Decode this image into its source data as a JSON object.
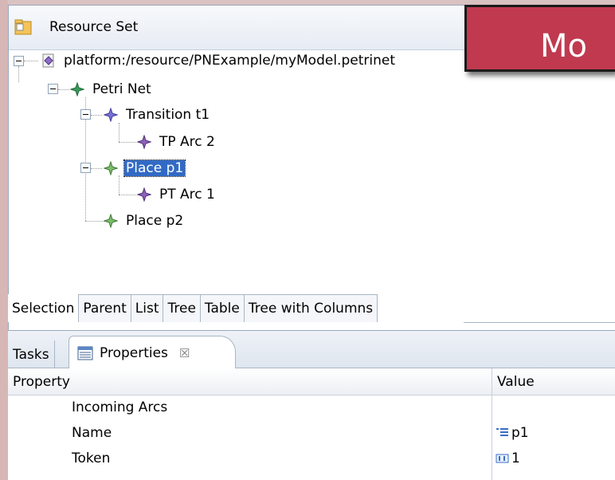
{
  "editor": {
    "header_title": "Resource Set",
    "tree": [
      {
        "label": "platform:/resource/PNExample/myModel.petrinet",
        "icon": "resource-file-icon"
      },
      {
        "label": "Petri Net",
        "icon": "petri-net-node-icon"
      },
      {
        "label": "Transition t1",
        "icon": "transition-node-icon"
      },
      {
        "label": "TP Arc 2",
        "icon": "arc-node-icon"
      },
      {
        "label": "Place p1",
        "icon": "place-node-icon",
        "selected": true
      },
      {
        "label": "PT Arc 1",
        "icon": "arc-node-icon"
      },
      {
        "label": "Place p2",
        "icon": "place-node-icon"
      }
    ],
    "viewer_tabs": [
      "Selection",
      "Parent",
      "List",
      "Tree",
      "Table",
      "Tree with Columns"
    ],
    "active_viewer_tab": "Selection"
  },
  "overlay": {
    "title_text": "Mo",
    "color": "#c0394f"
  },
  "properties_view": {
    "tabs": {
      "tasks": "Tasks",
      "properties": "Properties",
      "close_glyph": "☒"
    },
    "columns": [
      "Property",
      "Value"
    ],
    "rows": [
      {
        "property": "Incoming Arcs",
        "value": ""
      },
      {
        "property": "Name",
        "value": "p1",
        "value_icon": "text-value-icon"
      },
      {
        "property": "Token",
        "value": "1",
        "value_icon": "number-value-icon"
      }
    ]
  },
  "colors": {
    "selection": "#316ac5",
    "transition_gem": "#6a5acd",
    "place_gem": "#3a9a5a",
    "arc_gem": "#7b4ea8"
  }
}
